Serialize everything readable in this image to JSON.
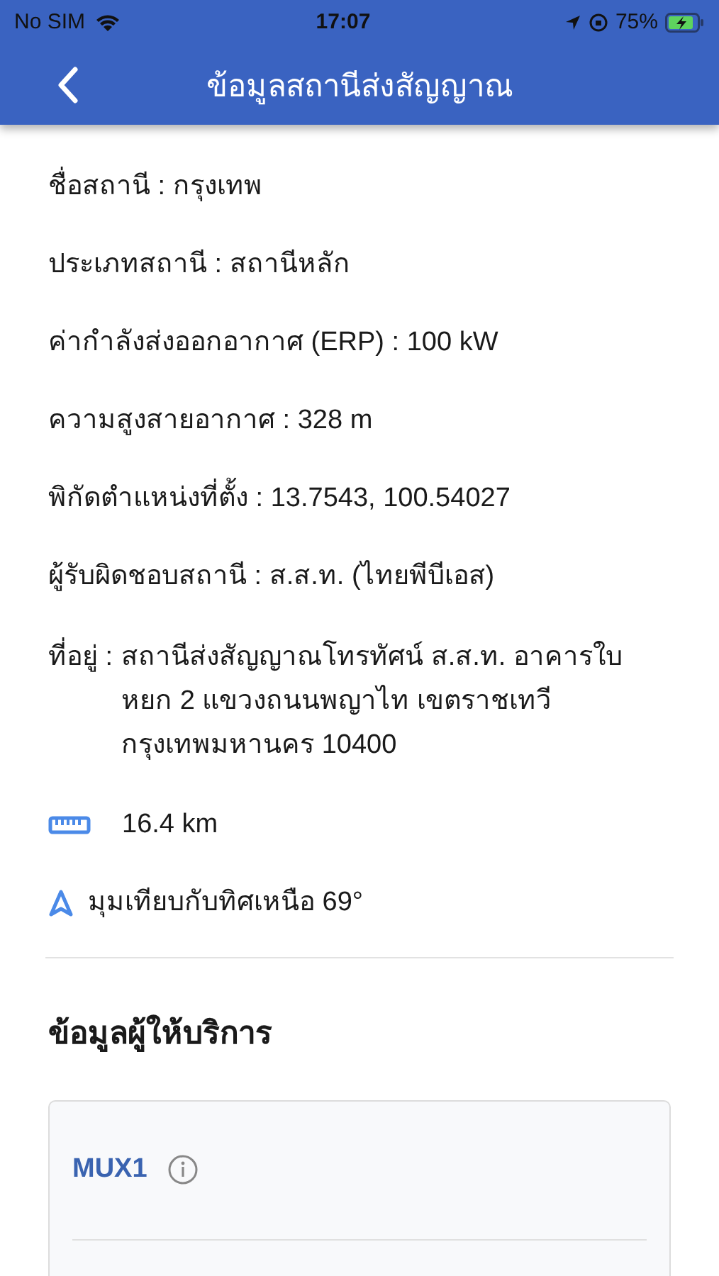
{
  "status_bar": {
    "carrier": "No SIM",
    "time": "17:07",
    "battery": "75%"
  },
  "header": {
    "title": "ข้อมูลสถานีส่งสัญญาณ"
  },
  "details": [
    "ชื่อสถานี : กรุงเทพ",
    "ประเภทสถานี : สถานีหลัก",
    "ค่ากำลังส่งออกอากาศ (ERP) : 100 kW",
    "ความสูงสายอากาศ : 328 m",
    "พิกัดตำแหน่งที่ตั้ง : 13.7543, 100.54027",
    "ผู้รับผิดชอบสถานี : ส.ส.ท. (ไทยพีบีเอส)"
  ],
  "address": {
    "label": "ที่อยู่ :",
    "value": "สถานีส่งสัญญาณโทรทัศน์  ส.ส.ท. อาคารใบหยก 2 แขวงถนนพญาไท เขตราชเทวี กรุงเทพมหานคร 10400"
  },
  "distance": "16.4 km",
  "bearing": "มุมเทียบกับทิศเหนือ 69°",
  "providers": {
    "heading": "ข้อมูลผู้ให้บริการ",
    "mux": "MUX1"
  }
}
